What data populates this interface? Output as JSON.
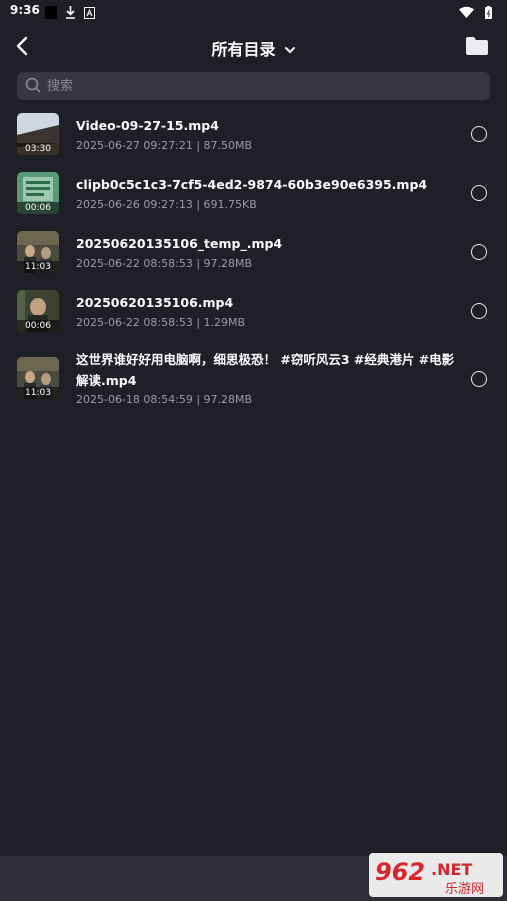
{
  "status": {
    "time": "9:36"
  },
  "header": {
    "title": "所有目录"
  },
  "search": {
    "placeholder": "搜索"
  },
  "files": [
    {
      "name": "Video-09-27-15.mp4",
      "meta": "2025-06-27 09:27:21 | 87.50MB",
      "duration": "03:30"
    },
    {
      "name": "clipb0c5c1c3-7cf5-4ed2-9874-60b3e90e6395.mp4",
      "meta": "2025-06-26 09:27:13 | 691.75KB",
      "duration": "00:06"
    },
    {
      "name": "20250620135106_temp_.mp4",
      "meta": "2025-06-22 08:58:53 | 97.28MB",
      "duration": "11:03"
    },
    {
      "name": "20250620135106.mp4",
      "meta": "2025-06-22 08:58:53 | 1.29MB",
      "duration": "00:06"
    },
    {
      "name": "这世界谁好好用电脑啊，细思极恐！ #窃听风云3 #经典港片 #电影解读.mp4",
      "meta": "2025-06-18 08:54:59 | 97.28MB",
      "duration": "11:03"
    }
  ],
  "watermark": {
    "number": "962",
    "dot": ".NET",
    "text": "乐游网"
  },
  "colors": {
    "background": "#1f1f28",
    "search_bg": "#363742",
    "meta": "#9a9ba3",
    "bottom_bar": "#2d2e36",
    "watermark_red": "#d8262c"
  },
  "icons": [
    "download-icon",
    "auto-icon",
    "wifi-icon",
    "battery-icon",
    "back-arrow-icon",
    "chevron-down-icon",
    "folder-icon",
    "search-icon",
    "radio-unchecked-icon"
  ]
}
